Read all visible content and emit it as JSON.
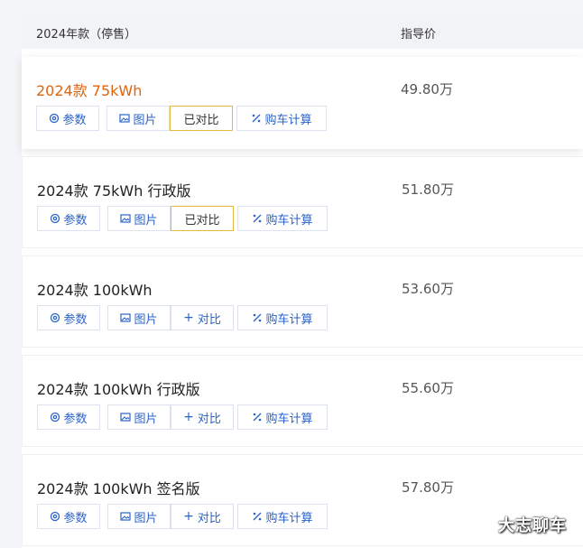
{
  "header": {
    "col_model": "2024年款（停售）",
    "col_price": "指导价"
  },
  "rows": [
    {
      "name": "2024款 75kWh",
      "price": "49.80万",
      "compare_label": "已对比",
      "compared": true
    },
    {
      "name": "2024款 75kWh 行政版",
      "price": "51.80万",
      "compare_label": "已对比",
      "compared": true
    },
    {
      "name": "2024款 100kWh",
      "price": "53.60万",
      "compare_label": "对比",
      "compared": false
    },
    {
      "name": "2024款 100kWh 行政版",
      "price": "55.60万",
      "compare_label": "对比",
      "compared": false
    },
    {
      "name": "2024款 100kWh 签名版",
      "price": "57.80万",
      "compare_label": "对比",
      "compared": false
    }
  ],
  "buttons": {
    "params": "参数",
    "photos": "图片",
    "calc": "购车计算"
  },
  "icons": {
    "params": "gear-icon",
    "photos": "image-icon",
    "add": "plus-icon",
    "calc": "percent-icon"
  },
  "colors": {
    "accent": "#e0640d",
    "link": "#2b63c9",
    "compared_border": "#e2b93b"
  },
  "watermark": "大志聊车"
}
